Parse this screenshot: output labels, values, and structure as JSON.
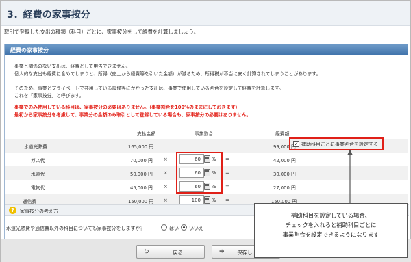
{
  "page": {
    "title": "3．経費の家事按分",
    "intro": "取引で登録した支出の種類（科目）ごとに、家事按分をして経費を計算しましょう。"
  },
  "panel": {
    "header": "経費の家事按分",
    "desc_lines": [
      "事業と関係のない支出は、経費として申告できません。",
      "個人的な支出も経費に含めてしまうと、所得（売上から経費等を引いた金額）が減るため、所得税が不当に安く計算されてしまうことがあります。",
      "そのため、事業とプライベートで共用している設備等にかかった支出は、事業で使用している割合を設定して経費を計算します。",
      "これを「家事按分」と呼びます。"
    ],
    "warn_lines": [
      "事業でのみ使用している科目は、家事按分の必要はありません。（事業割合を100%のままにしておきます）",
      "最初から家事按分を考慮して、事業分の金額のみ取引として登録している場合も、家事按分の必要はありません。"
    ]
  },
  "table": {
    "col_amount": "支払金額",
    "col_ratio": "事業割合",
    "col_expense": "経費額",
    "rows": [
      {
        "name": "水道光熱費",
        "amount": "165,000 円",
        "ratio": "",
        "expense": "99,000 円"
      },
      {
        "name": "ガス代",
        "amount": "70,000 円",
        "ratio": "60",
        "expense": "42,000 円"
      },
      {
        "name": "水道代",
        "amount": "50,000 円",
        "ratio": "60",
        "expense": "30,000 円"
      },
      {
        "name": "電気代",
        "amount": "45,000 円",
        "ratio": "60",
        "expense": "27,000 円"
      },
      {
        "name": "通信費",
        "amount": "150,000 円",
        "ratio": "100",
        "expense": "150,000 円"
      }
    ],
    "times": "×",
    "equals": "=",
    "percent": "%",
    "sub_ratio_checkbox": {
      "label": "補助科目ごとに事業割合を設定する",
      "checked": true,
      "check_mark": "✓"
    }
  },
  "help": {
    "icon": "?",
    "label": "家事按分の考え方"
  },
  "question": {
    "text": "水道光熱費や通信費以外の科目についても家事按分をしますか？",
    "yes": "はい",
    "no": "いいえ",
    "selected": "no"
  },
  "footer": {
    "back": "戻る",
    "back_icon": "⮌",
    "save": "保存し",
    "save_icon": "➔"
  },
  "callout": {
    "lines": [
      "補助科目を設定している場合、",
      "チェックを入れると補助科目ごとに",
      "事業割合を設定できるようになります"
    ]
  },
  "colors": {
    "accent": "#e02018",
    "header_blue": "#4a7db5"
  }
}
